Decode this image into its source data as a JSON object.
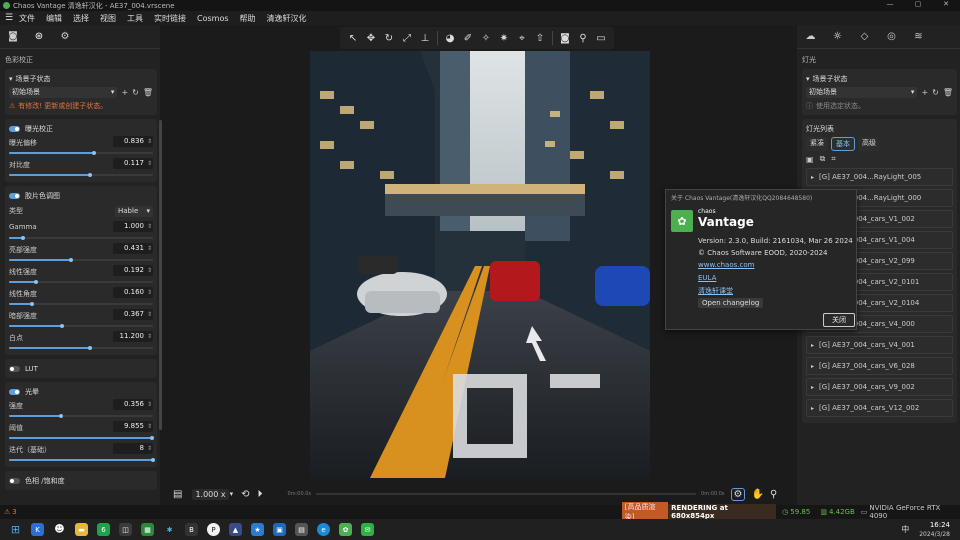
{
  "window": {
    "title": "Chaos Vantage 清逸轩汉化 - AE37_004.vrscene",
    "controls": [
      "—",
      "▢",
      "✕"
    ]
  },
  "menu": [
    "文件",
    "编辑",
    "选择",
    "视图",
    "工具",
    "实时链接",
    "Cosmos",
    "帮助",
    "清逸轩汉化"
  ],
  "left_panel": {
    "section_title": "色彩校正",
    "scene_state": {
      "header": "场景子状态",
      "dropdown_value": "初始场景",
      "warning": "有修改! 更新或创建子状态。"
    },
    "exposure": {
      "header": "曝光校正",
      "params": [
        {
          "label": "曝光偏移",
          "value": "0.836",
          "fraction": 0.59
        },
        {
          "label": "对比度",
          "value": "0.117",
          "fraction": 0.56
        }
      ]
    },
    "tonemap": {
      "header": "胶片色调图",
      "type_label": "类型",
      "type_value": "Hable",
      "params": [
        {
          "label": "Gamma",
          "value": "1.000",
          "fraction": 0.1
        },
        {
          "label": "亮部强度",
          "value": "0.431",
          "fraction": 0.43
        },
        {
          "label": "线性强度",
          "value": "0.192",
          "fraction": 0.19
        },
        {
          "label": "线性角度",
          "value": "0.160",
          "fraction": 0.16
        },
        {
          "label": "暗部强度",
          "value": "0.367",
          "fraction": 0.37
        },
        {
          "label": "白点",
          "value": "11.200",
          "fraction": 0.56
        }
      ]
    },
    "lut": {
      "header": "LUT"
    },
    "bloom": {
      "header": "光晕",
      "params": [
        {
          "label": "强度",
          "value": "0.356",
          "fraction": 0.36
        },
        {
          "label": "阈值",
          "value": "9.855",
          "fraction": 0.99
        },
        {
          "label": "迭代（基础）",
          "value": "8",
          "fraction": 1.0
        }
      ]
    },
    "color_balance": {
      "header": "色相 /饱和度"
    }
  },
  "viewport_bottom": {
    "zoom": "1.000 x",
    "time_start": "0m:00.0s",
    "time_end": "0m:00.0s"
  },
  "right_panel": {
    "section_title": "灯光",
    "scene_state": {
      "header": "场景子状态",
      "dropdown_value": "初始场景",
      "note": "使用选定状态。"
    },
    "light_list_title": "灯光列表",
    "view_modes": [
      "紧凑",
      "基本",
      "高级"
    ],
    "lights": [
      "[G] AE37_004...RayLight_005",
      "[G] AE37_004...RayLight_000",
      "[G] AE37_004_cars_V1_002",
      "[G] AE37_004_cars_V1_004",
      "[G] AE37_004_cars_V2_099",
      "[G] AE37_004_cars_V2_0101",
      "[G] AE37_004_cars_V2_0104",
      "[G] AE37_004_cars_V4_000",
      "[G] AE37_004_cars_V4_001",
      "[G] AE37_004_cars_V6_028",
      "[G] AE37_004_cars_V9_002",
      "[G] AE37_004_cars_V12_002"
    ]
  },
  "about_dialog": {
    "title": "关于 Chaos Vantage(清逸轩汉化QQ2084648580)",
    "brand_small": "chaos",
    "brand_big": "Vantage",
    "version": "Version: 2.3.0, Build: 2161034, Mar 26 2024",
    "copyright": "© Chaos Software EOOD, 2020-2024",
    "link1": "www.chaos.com",
    "link2": "EULA",
    "link3": "清逸轩课堂",
    "changelog_button": "Open changelog",
    "close_button": "关闭"
  },
  "status": {
    "warn_count": "3",
    "mode": "[高品质渲染]",
    "rendering": "RENDERING at 680x854px",
    "fps": "59.85",
    "memory": "4.42GB",
    "gpu": "NVIDIA GeForce RTX 4090"
  },
  "taskbar": {
    "time": "16:24",
    "date": "2024/3/28",
    "ime": "中"
  },
  "colors": {
    "accent": "#5e9edb",
    "warning": "#e0743b",
    "brand_green": "#4caf50"
  }
}
